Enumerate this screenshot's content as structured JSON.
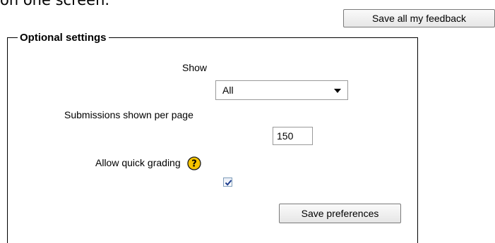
{
  "intro": {
    "text": "on one screen."
  },
  "toolbar": {
    "save_all_label": "Save all my feedback"
  },
  "settings": {
    "legend": "Optional settings",
    "show": {
      "label": "Show",
      "value": "All"
    },
    "per_page": {
      "label": "Submissions shown per page",
      "value": "150"
    },
    "quick_grading": {
      "label": "Allow quick grading",
      "checked": true
    },
    "save_label": "Save preferences"
  },
  "icons": {
    "help": "help-icon",
    "dropdown": "chevron-down-icon",
    "check": "check-icon"
  },
  "colors": {
    "help_icon_fill": "#f6c400",
    "check_mark": "#1f3f8f"
  }
}
